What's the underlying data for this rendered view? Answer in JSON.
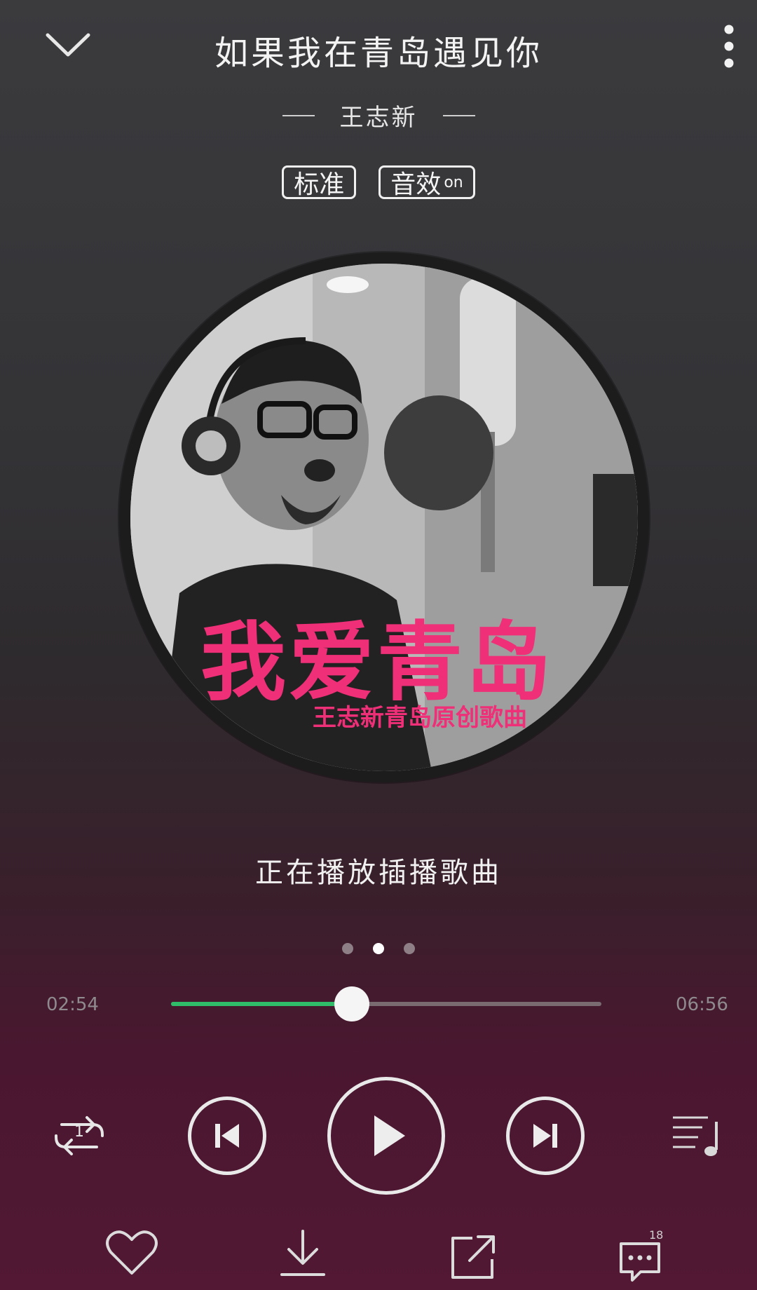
{
  "header": {
    "song_title": "如果我在青岛遇见你",
    "artist": "王志新",
    "quality_badge": "标准",
    "effect_badge": "音效",
    "effect_state": "on"
  },
  "album": {
    "cover_title": "我爱青岛",
    "cover_subtitle": "王志新青岛原创歌曲"
  },
  "status": {
    "now_playing": "正在播放插播歌曲"
  },
  "pager": {
    "count": 3,
    "active_index": 1
  },
  "progress": {
    "current_time": "02:54",
    "total_time": "06:56",
    "fraction": 0.42
  },
  "controls": {
    "repeat_mode": "1",
    "comment_count": "18"
  },
  "colors": {
    "accent_green": "#2fbd6a",
    "cover_pink": "#ef2f77"
  }
}
